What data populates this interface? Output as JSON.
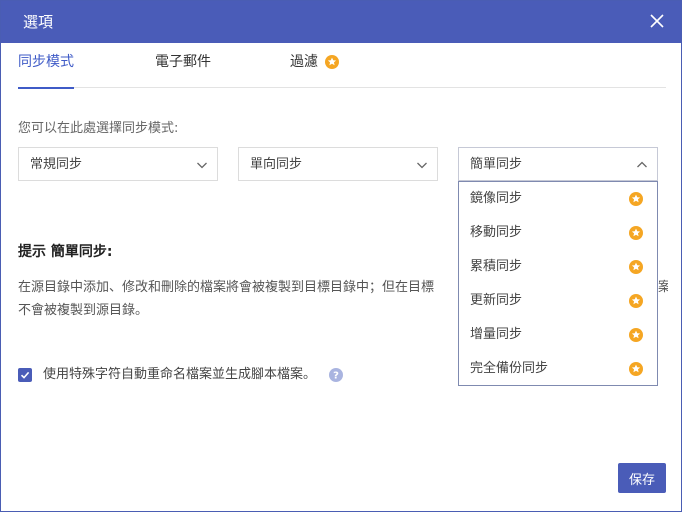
{
  "window": {
    "title": "選項"
  },
  "tabs": [
    {
      "label": "同步模式",
      "active": true
    },
    {
      "label": "電子郵件",
      "active": false
    },
    {
      "label": "過濾",
      "active": false,
      "badge_icon": "star-badge-icon"
    }
  ],
  "sync": {
    "mode_label": "您可以在此處選擇同步模式:",
    "selects": [
      {
        "value": "常規同步"
      },
      {
        "value": "單向同步"
      },
      {
        "value": "簡單同步",
        "open": true
      }
    ],
    "dropdown_options": [
      {
        "label": "鏡像同步",
        "icon": "star-badge-icon"
      },
      {
        "label": "移動同步",
        "icon": "star-badge-icon"
      },
      {
        "label": "累積同步",
        "icon": "star-badge-icon"
      },
      {
        "label": "更新同步",
        "icon": "star-badge-icon"
      },
      {
        "label": "增量同步",
        "icon": "star-badge-icon"
      },
      {
        "label": "完全備份同步",
        "icon": "star-badge-icon"
      }
    ]
  },
  "hint": {
    "title": "提示 簡單同步:",
    "line1": "在源目錄中添加、修改和刪除的檔案將會被複製到目標目錄中；但在目標",
    "line2": "不會被複製到源目錄。",
    "line1_tail": "案"
  },
  "options": {
    "auto_rename_checked": true,
    "auto_rename_label": "使用特殊字符自動重命名檔案並生成腳本檔案。"
  },
  "footer": {
    "save_label": "保存"
  },
  "colors": {
    "accent": "#4a5cb8",
    "active_tab": "#3f5bc7",
    "badge": "#f5a623",
    "help": "#a9b4e0"
  }
}
